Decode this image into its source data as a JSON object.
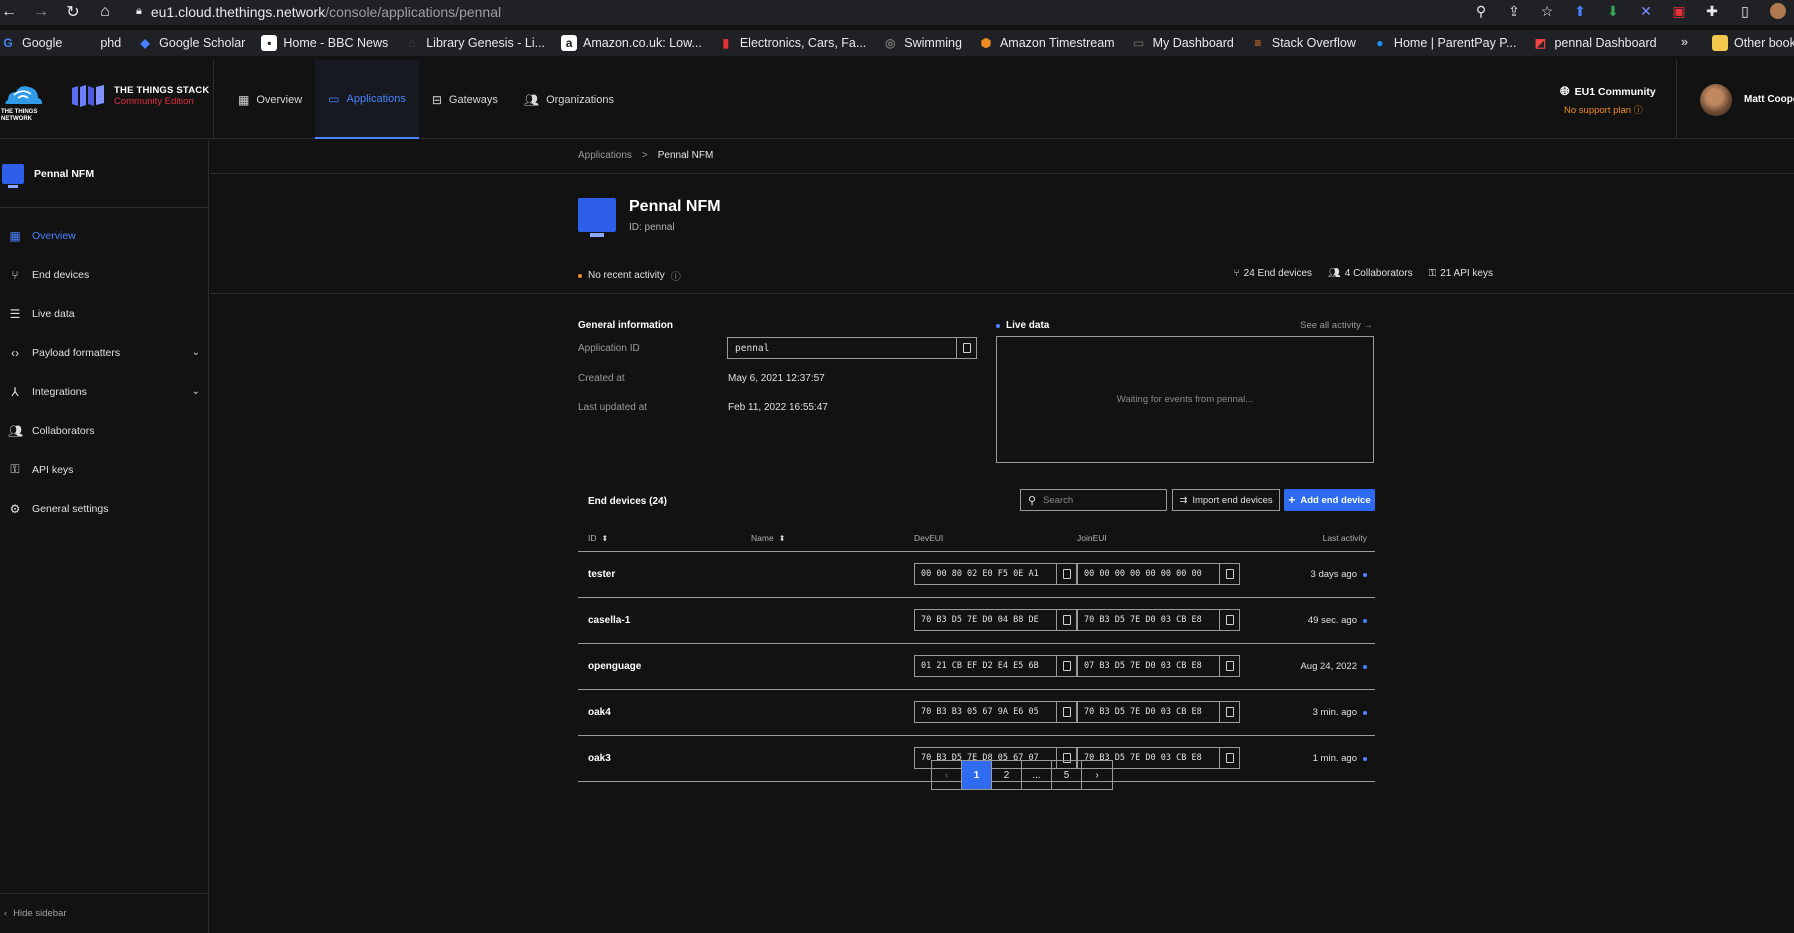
{
  "browser": {
    "url_host": "eu1.cloud.thethings.network",
    "url_path": "/console/applications/pennal",
    "bookmarks": [
      {
        "label": "Google",
        "color": "#4285f4",
        "glyph": "G"
      },
      {
        "label": "phd",
        "color": "#f2c94c",
        "glyph": ""
      },
      {
        "label": "Google Scholar",
        "color": "#4a7dff",
        "glyph": "◆"
      },
      {
        "label": "Home - BBC News",
        "color": "#ffffff",
        "glyph": "▪"
      },
      {
        "label": "Library Genesis - Li...",
        "color": "#444444",
        "glyph": "⌂"
      },
      {
        "label": "Amazon.co.uk: Low...",
        "color": "#ffffff",
        "glyph": "a"
      },
      {
        "label": "Electronics, Cars, Fa...",
        "color": "#e53238",
        "glyph": "▮"
      },
      {
        "label": "Swimming",
        "color": "#777777",
        "glyph": "◎"
      },
      {
        "label": "Amazon Timestream",
        "color": "#f08a24",
        "glyph": "⬢"
      },
      {
        "label": "My Dashboard",
        "color": "#555555",
        "glyph": "▭"
      },
      {
        "label": "Stack Overflow",
        "color": "#f48024",
        "glyph": "≡"
      },
      {
        "label": "Home | ParentPay P...",
        "color": "#1e90ff",
        "glyph": "●"
      },
      {
        "label": "pennal Dashboard",
        "color": "#ee4444",
        "glyph": "◩"
      }
    ],
    "more": "»",
    "other_bookmarks": "Other book"
  },
  "header": {
    "ttn_logo_text": "THE THINGS NETWORK",
    "stack_title": "THE THINGS STACK",
    "stack_sub": "Community Edition",
    "nav": [
      {
        "label": "Overview",
        "icon": "grid-icon",
        "active": false
      },
      {
        "label": "Applications",
        "icon": "desktop-icon",
        "active": true
      },
      {
        "label": "Gateways",
        "icon": "router-icon",
        "active": false
      },
      {
        "label": "Organizations",
        "icon": "people-icon",
        "active": false
      }
    ],
    "cluster": "EU1 Community",
    "support": "No support plan",
    "username": "Matt Coope"
  },
  "sidebar": {
    "app_name": "Pennal NFM",
    "items": [
      {
        "label": "Overview",
        "icon": "grid-icon",
        "active": true
      },
      {
        "label": "End devices",
        "icon": "device-tree-icon",
        "active": false
      },
      {
        "label": "Live data",
        "icon": "list-icon",
        "active": false
      },
      {
        "label": "Payload formatters",
        "icon": "code-icon",
        "active": false,
        "expandable": true
      },
      {
        "label": "Integrations",
        "icon": "merge-icon",
        "active": false,
        "expandable": true
      },
      {
        "label": "Collaborators",
        "icon": "people-icon",
        "active": false
      },
      {
        "label": "API keys",
        "icon": "key-icon",
        "active": false
      },
      {
        "label": "General settings",
        "icon": "gear-icon",
        "active": false
      }
    ],
    "hide_label": "Hide sidebar"
  },
  "breadcrumb": {
    "parent": "Applications",
    "sep": ">",
    "current": "Pennal NFM"
  },
  "app": {
    "name": "Pennal NFM",
    "id_line": "ID: pennal",
    "activity": "No recent activity",
    "stats": {
      "end_devices": "24 End devices",
      "collaborators": "4 Collaborators",
      "api_keys": "21 API keys"
    }
  },
  "general_info": {
    "title": "General information",
    "app_id_label": "Application ID",
    "app_id_value": "pennal",
    "created_label": "Created at",
    "created_value": "May 6, 2021 12:37:57",
    "updated_label": "Last updated at",
    "updated_value": "Feb 11, 2022 16:55:47"
  },
  "live_data": {
    "title": "Live data",
    "see_all": "See all activity →",
    "waiting": "Waiting for events from pennal..."
  },
  "end_devices": {
    "title": "End devices (24)",
    "search_placeholder": "Search",
    "import_label": "Import end devices",
    "add_label": "Add end device",
    "columns": {
      "id": "ID",
      "name": "Name",
      "deveui": "DevEUI",
      "joineui": "JoinEUI",
      "last": "Last activity"
    },
    "sort_glyph": "⬍",
    "rows": [
      {
        "id": "tester",
        "deveui": "00 00 80 02 E0 F5 0E A1",
        "joineui": "00 00 00 00 00 00 00 00",
        "last": "3 days ago"
      },
      {
        "id": "casella-1",
        "deveui": "70 B3 D5 7E D0 04 B8 DE",
        "joineui": "70 B3 D5 7E D0 03 CB E8",
        "last": "49 sec. ago"
      },
      {
        "id": "openguage",
        "deveui": "01 21 CB EF D2 E4 E5 6B",
        "joineui": "07 B3 D5 7E D0 03 CB E8",
        "last": "Aug 24, 2022"
      },
      {
        "id": "oak4",
        "deveui": "70 B3 B3 05 67 9A E6 05",
        "joineui": "70 B3 D5 7E D0 03 CB E8",
        "last": "3 min. ago"
      },
      {
        "id": "oak3",
        "deveui": "70 B3 D5 7E D8 05 67 07",
        "joineui": "70 B3 D5 7E D0 03 CB E8",
        "last": "1 min. ago"
      }
    ]
  },
  "pagination": {
    "prev": "‹",
    "pages": [
      "1",
      "2",
      "...",
      "5"
    ],
    "active": "1",
    "next": "›"
  },
  "colors": {
    "accent": "#4b83ff",
    "primary_button": "#2f6bf0",
    "warning": "#f08a24",
    "brand_red": "#e0303e"
  }
}
